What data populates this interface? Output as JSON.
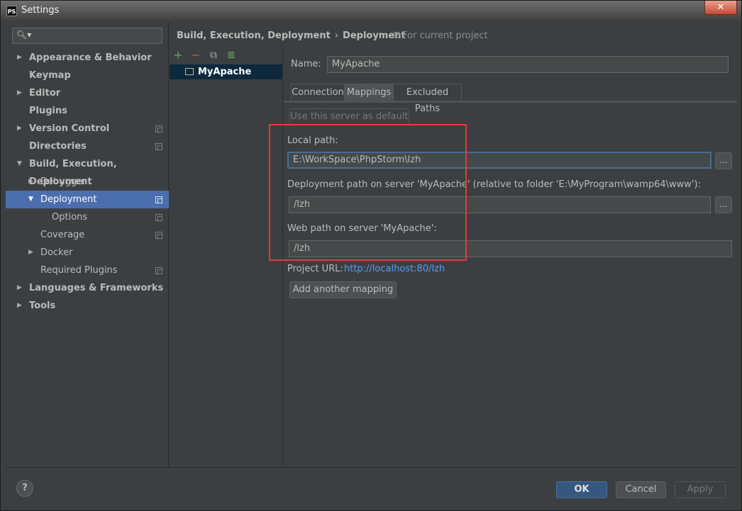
{
  "window": {
    "app_icon": "PS",
    "title": "Settings",
    "close_glyph": "✕"
  },
  "sidebar": {
    "search_placeholder": "",
    "items": [
      {
        "label": "Appearance & Behavior",
        "arrow": "▶"
      },
      {
        "label": "Keymap"
      },
      {
        "label": "Editor",
        "arrow": "▶"
      },
      {
        "label": "Plugins"
      },
      {
        "label": "Version Control",
        "arrow": "▶"
      },
      {
        "label": "Directories"
      },
      {
        "label": "Build, Execution, Deployment",
        "arrow": "▼"
      },
      {
        "label": "Debugger",
        "arrow": "▶"
      },
      {
        "label": "Deployment",
        "arrow": "▼"
      },
      {
        "label": "Options"
      },
      {
        "label": "Coverage"
      },
      {
        "label": "Docker",
        "arrow": "▶"
      },
      {
        "label": "Required Plugins"
      },
      {
        "label": "Languages & Frameworks",
        "arrow": "▶"
      },
      {
        "label": "Tools",
        "arrow": "▶"
      }
    ]
  },
  "breadcrumb": {
    "parent": "Build, Execution, Deployment",
    "separator": "›",
    "current": "Deployment",
    "scope": "For current project"
  },
  "toolbar": {
    "add": "+",
    "remove": "−",
    "copy": "⧉",
    "details": "≣"
  },
  "server": {
    "name_label": "Name:",
    "name_value": "MyApache"
  },
  "tabs": [
    "Connection",
    "Mappings",
    "Excluded Paths"
  ],
  "mappings": {
    "default_button": "Use this server as default",
    "local_path_label": "Local path:",
    "local_path_value": "E:\\WorkSpace\\PhpStorm\\lzh",
    "deploy_path_label": "Deployment path on server 'MyApache' (relative to folder 'E:\\MyProgram\\wamp64\\www'):",
    "deploy_path_value": "/lzh",
    "web_path_label": "Web path on server 'MyApache':",
    "web_path_value": "/lzh",
    "browse": "...",
    "project_url_label": "Project URL:",
    "project_url_value": "http://localhost:80/lzh",
    "add_mapping_button": "Add another mapping"
  },
  "footer": {
    "help": "?",
    "ok": "OK",
    "cancel": "Cancel",
    "apply": "Apply"
  },
  "colors": {
    "background": "#3c3f41",
    "selection": "#4b6eaf",
    "link": "#589df6",
    "highlight_box": "#e03c3c"
  }
}
